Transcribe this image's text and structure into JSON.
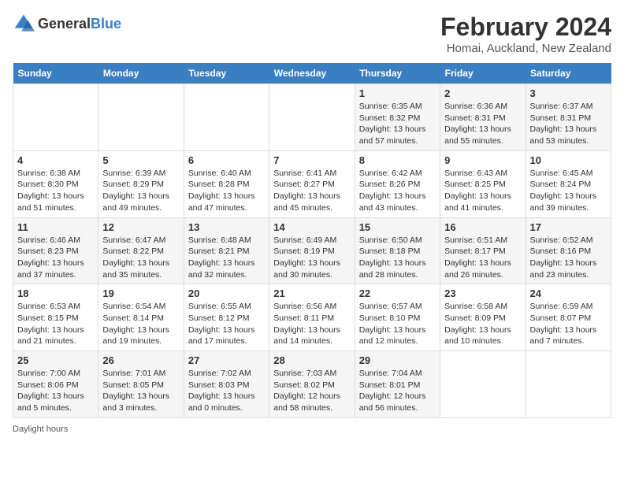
{
  "header": {
    "logo_general": "General",
    "logo_blue": "Blue",
    "main_title": "February 2024",
    "subtitle": "Homai, Auckland, New Zealand"
  },
  "columns": [
    "Sunday",
    "Monday",
    "Tuesday",
    "Wednesday",
    "Thursday",
    "Friday",
    "Saturday"
  ],
  "weeks": [
    [
      {
        "day": "",
        "sunrise": "",
        "sunset": "",
        "daylight": ""
      },
      {
        "day": "",
        "sunrise": "",
        "sunset": "",
        "daylight": ""
      },
      {
        "day": "",
        "sunrise": "",
        "sunset": "",
        "daylight": ""
      },
      {
        "day": "",
        "sunrise": "",
        "sunset": "",
        "daylight": ""
      },
      {
        "day": "1",
        "sunrise": "Sunrise: 6:35 AM",
        "sunset": "Sunset: 8:32 PM",
        "daylight": "Daylight: 13 hours and 57 minutes."
      },
      {
        "day": "2",
        "sunrise": "Sunrise: 6:36 AM",
        "sunset": "Sunset: 8:31 PM",
        "daylight": "Daylight: 13 hours and 55 minutes."
      },
      {
        "day": "3",
        "sunrise": "Sunrise: 6:37 AM",
        "sunset": "Sunset: 8:31 PM",
        "daylight": "Daylight: 13 hours and 53 minutes."
      }
    ],
    [
      {
        "day": "4",
        "sunrise": "Sunrise: 6:38 AM",
        "sunset": "Sunset: 8:30 PM",
        "daylight": "Daylight: 13 hours and 51 minutes."
      },
      {
        "day": "5",
        "sunrise": "Sunrise: 6:39 AM",
        "sunset": "Sunset: 8:29 PM",
        "daylight": "Daylight: 13 hours and 49 minutes."
      },
      {
        "day": "6",
        "sunrise": "Sunrise: 6:40 AM",
        "sunset": "Sunset: 8:28 PM",
        "daylight": "Daylight: 13 hours and 47 minutes."
      },
      {
        "day": "7",
        "sunrise": "Sunrise: 6:41 AM",
        "sunset": "Sunset: 8:27 PM",
        "daylight": "Daylight: 13 hours and 45 minutes."
      },
      {
        "day": "8",
        "sunrise": "Sunrise: 6:42 AM",
        "sunset": "Sunset: 8:26 PM",
        "daylight": "Daylight: 13 hours and 43 minutes."
      },
      {
        "day": "9",
        "sunrise": "Sunrise: 6:43 AM",
        "sunset": "Sunset: 8:25 PM",
        "daylight": "Daylight: 13 hours and 41 minutes."
      },
      {
        "day": "10",
        "sunrise": "Sunrise: 6:45 AM",
        "sunset": "Sunset: 8:24 PM",
        "daylight": "Daylight: 13 hours and 39 minutes."
      }
    ],
    [
      {
        "day": "11",
        "sunrise": "Sunrise: 6:46 AM",
        "sunset": "Sunset: 8:23 PM",
        "daylight": "Daylight: 13 hours and 37 minutes."
      },
      {
        "day": "12",
        "sunrise": "Sunrise: 6:47 AM",
        "sunset": "Sunset: 8:22 PM",
        "daylight": "Daylight: 13 hours and 35 minutes."
      },
      {
        "day": "13",
        "sunrise": "Sunrise: 6:48 AM",
        "sunset": "Sunset: 8:21 PM",
        "daylight": "Daylight: 13 hours and 32 minutes."
      },
      {
        "day": "14",
        "sunrise": "Sunrise: 6:49 AM",
        "sunset": "Sunset: 8:19 PM",
        "daylight": "Daylight: 13 hours and 30 minutes."
      },
      {
        "day": "15",
        "sunrise": "Sunrise: 6:50 AM",
        "sunset": "Sunset: 8:18 PM",
        "daylight": "Daylight: 13 hours and 28 minutes."
      },
      {
        "day": "16",
        "sunrise": "Sunrise: 6:51 AM",
        "sunset": "Sunset: 8:17 PM",
        "daylight": "Daylight: 13 hours and 26 minutes."
      },
      {
        "day": "17",
        "sunrise": "Sunrise: 6:52 AM",
        "sunset": "Sunset: 8:16 PM",
        "daylight": "Daylight: 13 hours and 23 minutes."
      }
    ],
    [
      {
        "day": "18",
        "sunrise": "Sunrise: 6:53 AM",
        "sunset": "Sunset: 8:15 PM",
        "daylight": "Daylight: 13 hours and 21 minutes."
      },
      {
        "day": "19",
        "sunrise": "Sunrise: 6:54 AM",
        "sunset": "Sunset: 8:14 PM",
        "daylight": "Daylight: 13 hours and 19 minutes."
      },
      {
        "day": "20",
        "sunrise": "Sunrise: 6:55 AM",
        "sunset": "Sunset: 8:12 PM",
        "daylight": "Daylight: 13 hours and 17 minutes."
      },
      {
        "day": "21",
        "sunrise": "Sunrise: 6:56 AM",
        "sunset": "Sunset: 8:11 PM",
        "daylight": "Daylight: 13 hours and 14 minutes."
      },
      {
        "day": "22",
        "sunrise": "Sunrise: 6:57 AM",
        "sunset": "Sunset: 8:10 PM",
        "daylight": "Daylight: 13 hours and 12 minutes."
      },
      {
        "day": "23",
        "sunrise": "Sunrise: 6:58 AM",
        "sunset": "Sunset: 8:09 PM",
        "daylight": "Daylight: 13 hours and 10 minutes."
      },
      {
        "day": "24",
        "sunrise": "Sunrise: 6:59 AM",
        "sunset": "Sunset: 8:07 PM",
        "daylight": "Daylight: 13 hours and 7 minutes."
      }
    ],
    [
      {
        "day": "25",
        "sunrise": "Sunrise: 7:00 AM",
        "sunset": "Sunset: 8:06 PM",
        "daylight": "Daylight: 13 hours and 5 minutes."
      },
      {
        "day": "26",
        "sunrise": "Sunrise: 7:01 AM",
        "sunset": "Sunset: 8:05 PM",
        "daylight": "Daylight: 13 hours and 3 minutes."
      },
      {
        "day": "27",
        "sunrise": "Sunrise: 7:02 AM",
        "sunset": "Sunset: 8:03 PM",
        "daylight": "Daylight: 13 hours and 0 minutes."
      },
      {
        "day": "28",
        "sunrise": "Sunrise: 7:03 AM",
        "sunset": "Sunset: 8:02 PM",
        "daylight": "Daylight: 12 hours and 58 minutes."
      },
      {
        "day": "29",
        "sunrise": "Sunrise: 7:04 AM",
        "sunset": "Sunset: 8:01 PM",
        "daylight": "Daylight: 12 hours and 56 minutes."
      },
      {
        "day": "",
        "sunrise": "",
        "sunset": "",
        "daylight": ""
      },
      {
        "day": "",
        "sunrise": "",
        "sunset": "",
        "daylight": ""
      }
    ]
  ],
  "footer": {
    "daylight_label": "Daylight hours"
  }
}
